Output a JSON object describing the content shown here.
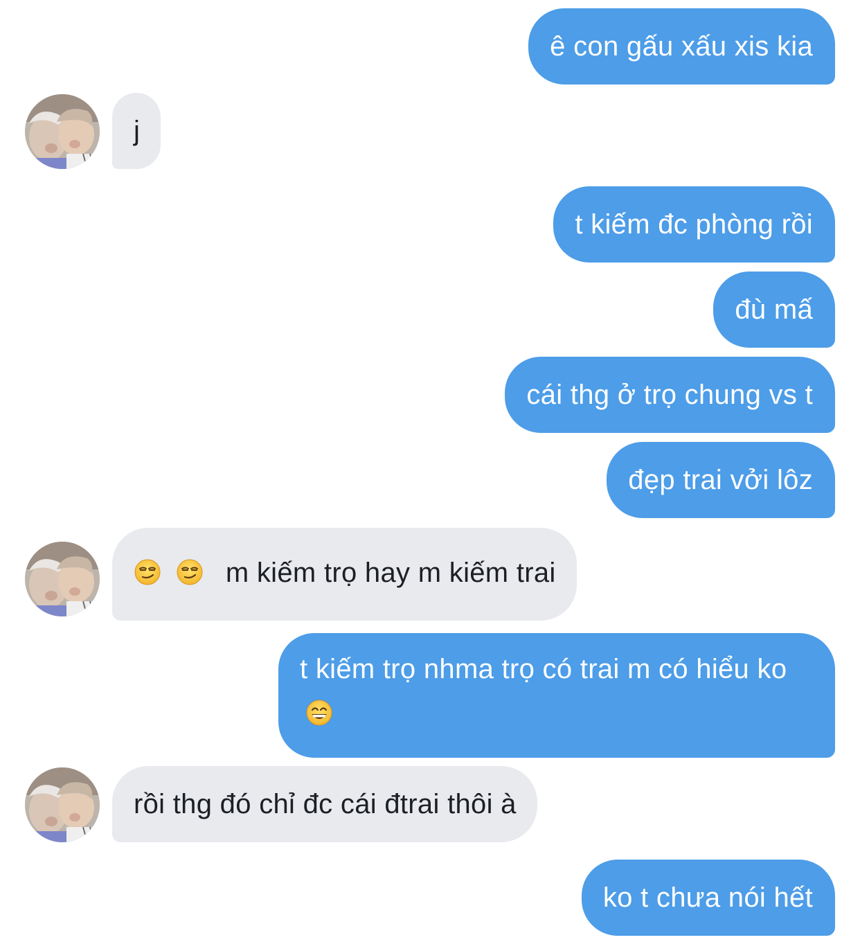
{
  "conversation": {
    "messages": [
      {
        "from": "me",
        "text": "ê con gấu xấu xis kia"
      },
      {
        "from": "friend",
        "text": "j"
      },
      {
        "from": "me",
        "text": "t kiếm đc phòng rồi"
      },
      {
        "from": "me",
        "text": "đù mấ"
      },
      {
        "from": "me",
        "text": "cái thg ở trọ chung vs t"
      },
      {
        "from": "me",
        "text": "đẹp trai vởi lôz"
      },
      {
        "from": "friend",
        "emoji_prefix": [
          "smirking-face",
          "smirking-face"
        ],
        "text": "m kiếm trọ hay m kiếm trai"
      },
      {
        "from": "me",
        "text": "t kiếm trọ nhma trọ có trai m có hiểu ko",
        "emoji_suffix": "grinning-face-with-smiling-eyes"
      },
      {
        "from": "friend",
        "text": "rồi thg đó chỉ đc cái đtrai thôi à"
      },
      {
        "from": "me",
        "text": "ko t chưa nói hết"
      }
    ]
  },
  "colors": {
    "outgoing_bubble": "#4d9de8",
    "incoming_bubble": "#e8eaee",
    "outgoing_text": "#ffffff",
    "incoming_text": "#1c1f24"
  }
}
